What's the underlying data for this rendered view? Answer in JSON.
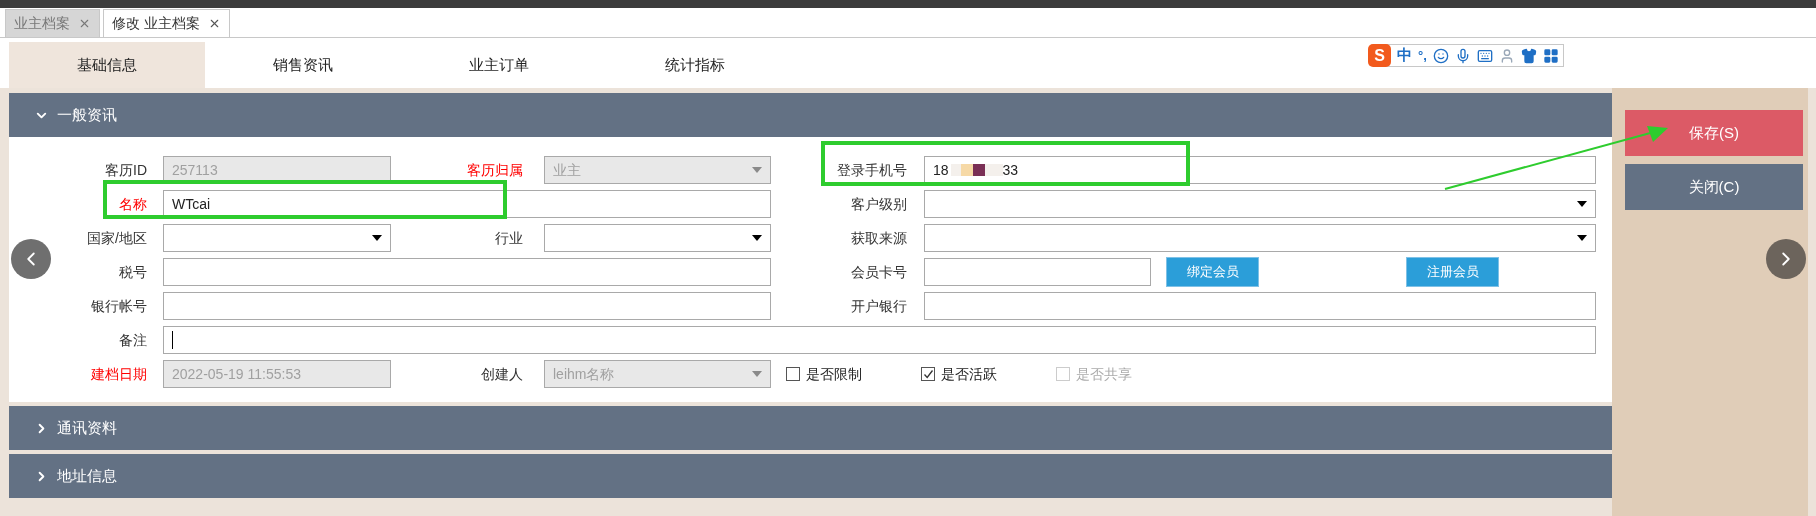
{
  "doc_tabs": [
    {
      "label": "业主档案",
      "selected": false
    },
    {
      "label": "修改 业主档案",
      "selected": true
    }
  ],
  "sub_tabs": [
    {
      "label": "基础信息",
      "selected": true
    },
    {
      "label": "销售资讯",
      "selected": false
    },
    {
      "label": "业主订单",
      "selected": false
    },
    {
      "label": "统计指标",
      "selected": false
    }
  ],
  "ime_toolbar": {
    "logo": "S",
    "mode": "中",
    "punctuation": "°,"
  },
  "sections": [
    {
      "title": "一般资讯",
      "expanded": true
    },
    {
      "title": "通讯资料",
      "expanded": false
    },
    {
      "title": "地址信息",
      "expanded": false
    }
  ],
  "form_rows": [
    [
      {
        "kind": "text",
        "label": "客历ID",
        "required": false,
        "value": "257113",
        "disabled": true
      },
      {
        "kind": "select",
        "label": "客历归属",
        "required": true,
        "value": "业主",
        "disabled": true
      },
      {
        "kind": "phone",
        "label": "登录手机号",
        "required": false,
        "value_start": "18",
        "value_end": "33",
        "disabled": false
      }
    ],
    [
      {
        "kind": "text",
        "label": "名称",
        "required": true,
        "value": "WTcai",
        "disabled": false
      },
      {
        "kind": "select",
        "label": "客户级别",
        "required": false,
        "disabled": false
      }
    ],
    [
      {
        "kind": "select",
        "label": "国家/地区",
        "required": false,
        "disabled": false
      },
      {
        "kind": "select",
        "label": "行业",
        "required": false,
        "disabled": false
      },
      {
        "kind": "select",
        "label": "获取来源",
        "required": false,
        "disabled": false
      }
    ],
    [
      {
        "kind": "text",
        "label": "税号",
        "required": false,
        "disabled": false
      },
      {
        "kind": "card",
        "label": "会员卡号",
        "required": false,
        "disabled": false,
        "buttons": [
          "绑定会员",
          "注册会员"
        ]
      }
    ],
    [
      {
        "kind": "text",
        "label": "银行帐号",
        "required": false,
        "disabled": false
      },
      {
        "kind": "text",
        "label": "开户银行",
        "required": false,
        "disabled": false
      }
    ],
    [
      {
        "kind": "text",
        "label": "备注",
        "required": false,
        "disabled": false,
        "focused": true
      }
    ],
    [
      {
        "kind": "text",
        "label": "建档日期",
        "required": true,
        "value": "2022-05-19 11:55:53",
        "disabled": true
      },
      {
        "kind": "select",
        "label": "创建人",
        "required": false,
        "value": "leihm名称",
        "disabled": true
      },
      {
        "kind": "checkboxes",
        "items": [
          {
            "label": "是否限制",
            "checked": false,
            "disabled": false
          },
          {
            "label": "是否活跃",
            "checked": true,
            "disabled": false
          },
          {
            "label": "是否共享",
            "checked": false,
            "disabled": true
          }
        ]
      }
    ]
  ],
  "side_buttons": [
    {
      "label": "保存(S)",
      "kind": "primary"
    },
    {
      "label": "关闭(C)",
      "kind": "secondary"
    }
  ]
}
